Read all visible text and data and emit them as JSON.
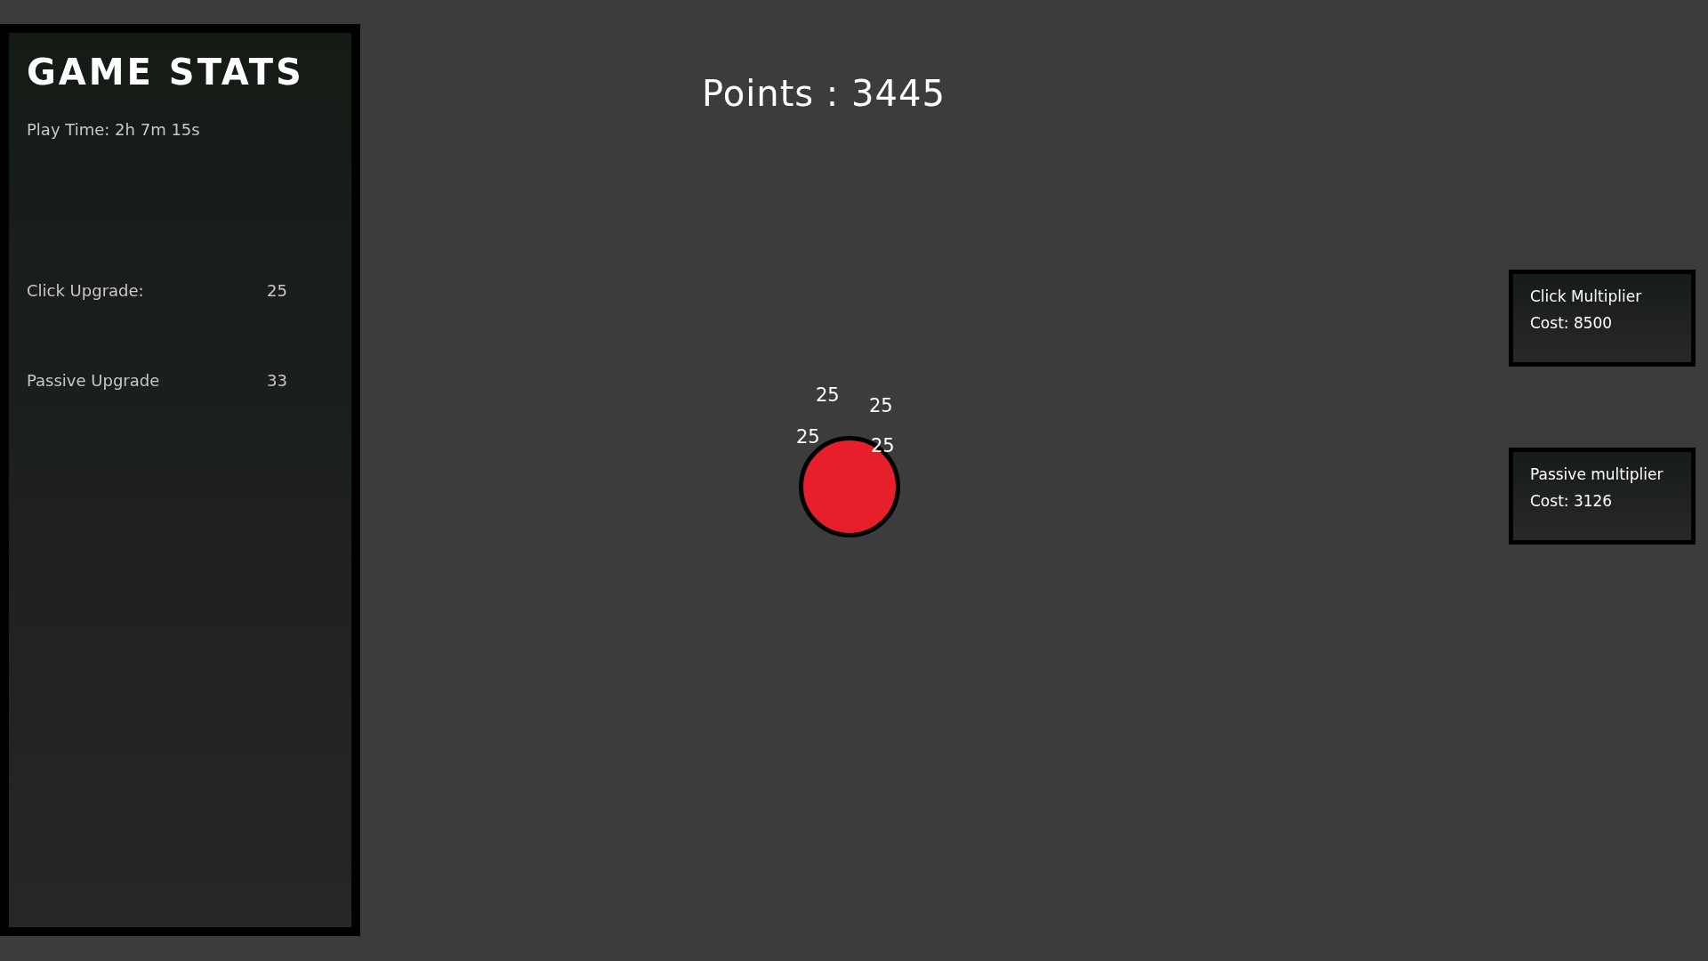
{
  "sidebar": {
    "title": "GAME STATS",
    "play_time": "Play Time: 2h 7m 15s",
    "stats": [
      {
        "label": "Click Upgrade:",
        "value": "25"
      },
      {
        "label": "Passive Upgrade",
        "value": "33"
      }
    ]
  },
  "points": "Points : 3445",
  "click_popups": [
    "25",
    "25",
    "25",
    "25"
  ],
  "upgrades": [
    {
      "name": "Click Multiplier",
      "cost": "Cost: 8500"
    },
    {
      "name": "Passive multiplier",
      "cost": "Cost: 3126"
    }
  ]
}
